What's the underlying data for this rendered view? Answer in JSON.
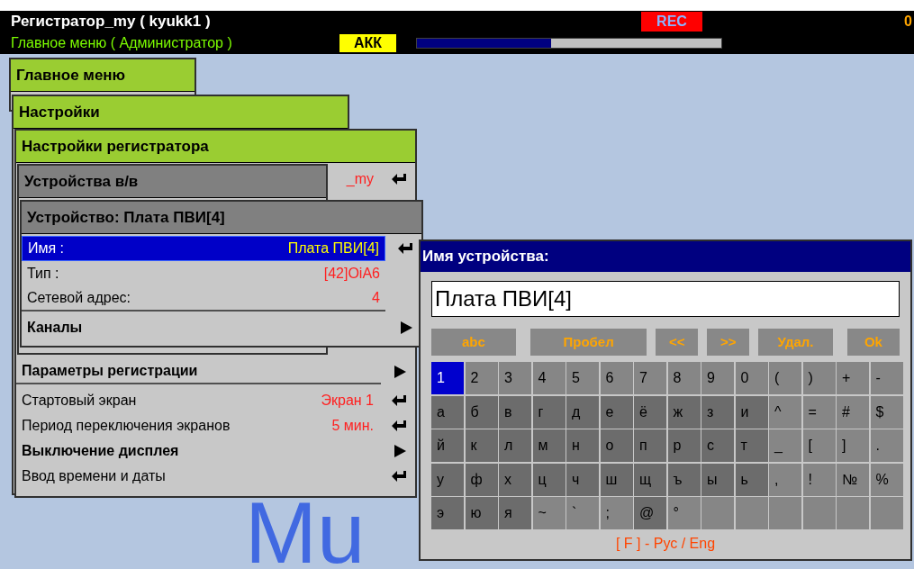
{
  "header": {
    "title": "Регистратор_my ( kyukk1 )",
    "subtitle": "Главное меню ( Администратор )",
    "rec": "REC",
    "corner": "0",
    "battery_label": "АКК",
    "battery": {
      "level": 0.44
    }
  },
  "background_logo": "Mu",
  "windows": [
    {
      "title": "Главное меню",
      "kind": "green"
    },
    {
      "title": "Настройки",
      "kind": "green"
    },
    {
      "title": "Настройки регистратора",
      "kind": "green",
      "items": [
        {
          "kind": "enter",
          "value": "_my"
        },
        {
          "kind": "submenu",
          "label": "Параметры регистрации",
          "divider_after": true
        },
        {
          "kind": "enter",
          "label": "Стартовый экран",
          "value": "Экран 1"
        },
        {
          "kind": "enter",
          "label": "Период переключения экранов",
          "value": "5 мин."
        },
        {
          "kind": "submenu",
          "label": "Выключение дисплея"
        },
        {
          "kind": "enter",
          "label": "Ввод времени и даты"
        }
      ]
    },
    {
      "title": "Устройства в/в",
      "kind": "gray"
    },
    {
      "title": "Устройство: Плата ПВИ[4]",
      "kind": "gray",
      "items": [
        {
          "kind": "enter",
          "label": "Имя :",
          "value": "Плата ПВИ[4]",
          "selected": true
        },
        {
          "kind": "info",
          "label": "Тип :",
          "value": "[42]OiA6",
          "selected": false
        },
        {
          "kind": "info",
          "label": "Сетевой адрес:",
          "value": "4",
          "selected": false,
          "divider_after": true
        },
        {
          "kind": "submenu",
          "label": "Каналы",
          "selected": false
        }
      ]
    }
  ],
  "keyboard": {
    "title": "Имя устройства:",
    "value": "Плата ПВИ[4]",
    "buttons": [
      "abc",
      "Пробел",
      "<<",
      ">>",
      "Удал.",
      "Ok"
    ],
    "rows": [
      [
        {
          "label": "1",
          "kind": "symbol",
          "selected": true
        },
        {
          "label": "2",
          "kind": "symbol",
          "selected": false
        },
        {
          "label": "3",
          "kind": "symbol",
          "selected": false
        },
        {
          "label": "4",
          "kind": "symbol",
          "selected": false
        },
        {
          "label": "5",
          "kind": "symbol",
          "selected": false
        },
        {
          "label": "6",
          "kind": "symbol",
          "selected": false
        },
        {
          "label": "7",
          "kind": "symbol",
          "selected": false
        },
        {
          "label": "8",
          "kind": "symbol",
          "selected": false
        },
        {
          "label": "9",
          "kind": "symbol",
          "selected": false
        },
        {
          "label": "0",
          "kind": "symbol",
          "selected": false
        },
        {
          "label": "(",
          "kind": "symbol",
          "selected": false
        },
        {
          "label": ")",
          "kind": "symbol",
          "selected": false
        },
        {
          "label": "+",
          "kind": "symbol",
          "selected": false
        },
        {
          "label": "-",
          "kind": "symbol",
          "selected": false
        }
      ],
      [
        {
          "label": "а",
          "kind": "letter",
          "selected": false
        },
        {
          "label": "б",
          "kind": "letter",
          "selected": false
        },
        {
          "label": "в",
          "kind": "letter",
          "selected": false
        },
        {
          "label": "г",
          "kind": "letter",
          "selected": false
        },
        {
          "label": "д",
          "kind": "letter",
          "selected": false
        },
        {
          "label": "е",
          "kind": "letter",
          "selected": false
        },
        {
          "label": "ё",
          "kind": "letter",
          "selected": false
        },
        {
          "label": "ж",
          "kind": "letter",
          "selected": false
        },
        {
          "label": "з",
          "kind": "letter",
          "selected": false
        },
        {
          "label": "и",
          "kind": "letter",
          "selected": false
        },
        {
          "label": "^",
          "kind": "symbol",
          "selected": false
        },
        {
          "label": "=",
          "kind": "symbol",
          "selected": false
        },
        {
          "label": "#",
          "kind": "symbol",
          "selected": false
        },
        {
          "label": "$",
          "kind": "symbol",
          "selected": false
        }
      ],
      [
        {
          "label": "й",
          "kind": "letter",
          "selected": false
        },
        {
          "label": "к",
          "kind": "letter",
          "selected": false
        },
        {
          "label": "л",
          "kind": "letter",
          "selected": false
        },
        {
          "label": "м",
          "kind": "letter",
          "selected": false
        },
        {
          "label": "н",
          "kind": "letter",
          "selected": false
        },
        {
          "label": "о",
          "kind": "letter",
          "selected": false
        },
        {
          "label": "п",
          "kind": "letter",
          "selected": false
        },
        {
          "label": "р",
          "kind": "letter",
          "selected": false
        },
        {
          "label": "с",
          "kind": "letter",
          "selected": false
        },
        {
          "label": "т",
          "kind": "letter",
          "selected": false
        },
        {
          "label": "_",
          "kind": "symbol",
          "selected": false
        },
        {
          "label": "[",
          "kind": "symbol",
          "selected": false
        },
        {
          "label": "]",
          "kind": "symbol",
          "selected": false
        },
        {
          "label": ".",
          "kind": "symbol",
          "selected": false
        }
      ],
      [
        {
          "label": "у",
          "kind": "letter",
          "selected": false
        },
        {
          "label": "ф",
          "kind": "letter",
          "selected": false
        },
        {
          "label": "х",
          "kind": "letter",
          "selected": false
        },
        {
          "label": "ц",
          "kind": "letter",
          "selected": false
        },
        {
          "label": "ч",
          "kind": "letter",
          "selected": false
        },
        {
          "label": "ш",
          "kind": "letter",
          "selected": false
        },
        {
          "label": "щ",
          "kind": "letter",
          "selected": false
        },
        {
          "label": "ъ",
          "kind": "letter",
          "selected": false
        },
        {
          "label": "ы",
          "kind": "letter",
          "selected": false
        },
        {
          "label": "ь",
          "kind": "letter",
          "selected": false
        },
        {
          "label": ",",
          "kind": "symbol",
          "selected": false
        },
        {
          "label": "!",
          "kind": "symbol",
          "selected": false
        },
        {
          "label": "№",
          "kind": "symbol",
          "selected": false
        },
        {
          "label": "%",
          "kind": "symbol",
          "selected": false
        }
      ],
      [
        {
          "label": "э",
          "kind": "letter",
          "selected": false
        },
        {
          "label": "ю",
          "kind": "letter",
          "selected": false
        },
        {
          "label": "я",
          "kind": "letter",
          "selected": false
        },
        {
          "label": "~",
          "kind": "symbol",
          "selected": false
        },
        {
          "label": "`",
          "kind": "symbol",
          "selected": false
        },
        {
          "label": ";",
          "kind": "symbol",
          "selected": false
        },
        {
          "label": "@",
          "kind": "letter",
          "selected": false
        },
        {
          "label": "°",
          "kind": "symbol",
          "selected": false
        }
      ]
    ],
    "footer": "[ F ] - Рус / Eng"
  }
}
